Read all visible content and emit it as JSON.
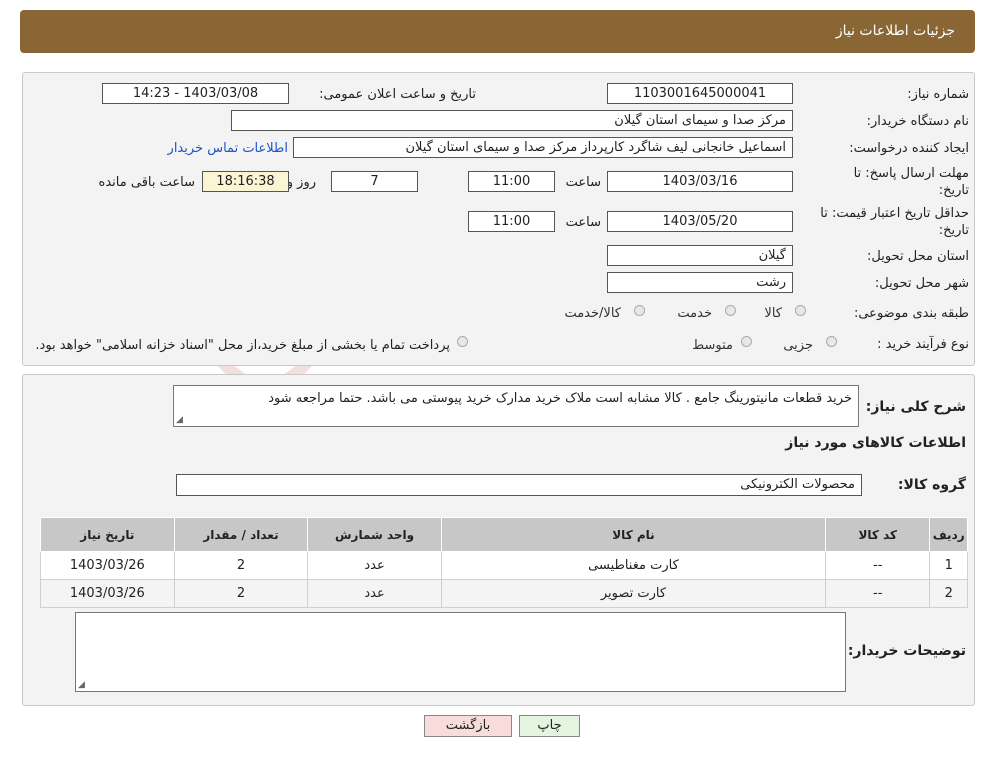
{
  "header": {
    "title": "جزئیات اطلاعات نیاز"
  },
  "form": {
    "need_number_label": "شماره نیاز:",
    "need_number": "1103001645000041",
    "announce_label": "تاریخ و ساعت اعلان عمومی:",
    "announce_value": "1403/03/08 - 14:23",
    "buyer_org_label": "نام دستگاه خریدار:",
    "buyer_org": "مرکز صدا و سیمای استان گیلان",
    "creator_label": "ایجاد کننده درخواست:",
    "creator": "اسماعیل خانجانی لیف شاگرد کارپرداز مرکز صدا و سیمای استان گیلان",
    "contact_link": "اطلاعات تماس خریدار",
    "deadline_label_1": "مهلت ارسال پاسخ: تا",
    "deadline_label_2": "تاریخ:",
    "deadline_date": "1403/03/16",
    "time_label": "ساعت",
    "deadline_time": "11:00",
    "days_value": "7",
    "days_label": "روز و",
    "remaining_time": "18:16:38",
    "remaining_label": "ساعت باقی مانده",
    "validity_label_1": "حداقل تاریخ اعتبار قیمت: تا",
    "validity_label_2": "تاریخ:",
    "validity_date": "1403/05/20",
    "validity_time": "11:00",
    "province_label": "استان محل تحویل:",
    "province": "گیلان",
    "city_label": "شهر محل تحویل:",
    "city": "رشت",
    "category_label": "طبقه بندی موضوعی:",
    "category_options": [
      "کالا",
      "خدمت",
      "کالا/خدمت"
    ],
    "process_label": "نوع فرآیند خرید :",
    "process_options": [
      "جزیی",
      "متوسط"
    ],
    "process_note": "پرداخت تمام یا بخشی از مبلغ خرید،از محل \"اسناد خزانه اسلامی\" خواهد بود."
  },
  "details": {
    "description_label": "شرح کلی نیاز:",
    "description": "خرید قطعات مانیتورینگ جامع . کالا مشابه است ملاک خرید مدارک خرید پیوستی می باشد. حتما مراجعه شود",
    "goods_info_title": "اطلاعات کالاهای مورد نیاز",
    "goods_group_label": "گروه کالا:",
    "goods_group": "محصولات الکترونیکی",
    "table": {
      "headers": [
        "ردیف",
        "کد کالا",
        "نام کالا",
        "واحد شمارش",
        "تعداد / مقدار",
        "تاریخ نیاز"
      ],
      "rows": [
        [
          "1",
          "--",
          "کارت مغناطیسی",
          "عدد",
          "2",
          "1403/03/26"
        ],
        [
          "2",
          "--",
          "کارت تصویر",
          "عدد",
          "2",
          "1403/03/26"
        ]
      ]
    },
    "buyer_notes_label": "توضیحات خریدار:",
    "buyer_notes": ""
  },
  "buttons": {
    "print": "چاپ",
    "back": "بازگشت"
  },
  "watermark": {
    "text": "AriaTender.neT"
  },
  "colors": {
    "header_bg": "#8a6635",
    "print_bg": "#e4f5df",
    "back_bg": "#f8dcdc",
    "link": "#1a55c9"
  }
}
